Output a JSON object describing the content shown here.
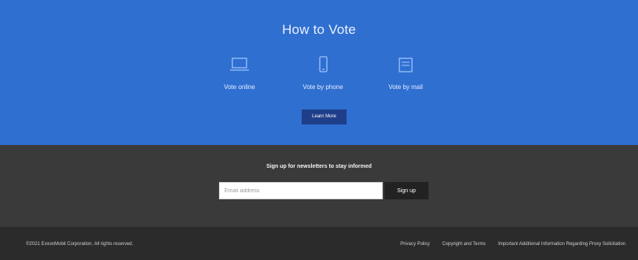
{
  "vote": {
    "title": "How to Vote",
    "options": [
      {
        "label": "Vote online",
        "icon": "laptop-icon"
      },
      {
        "label": "Vote by phone",
        "icon": "phone-icon"
      },
      {
        "label": "Vote by mail",
        "icon": "ballot-mail-icon"
      }
    ],
    "learn_more_label": "Learn More"
  },
  "signup": {
    "heading": "Sign up for newsletters to stay informed",
    "email_placeholder": "Email address",
    "button_label": "Sign up"
  },
  "footer": {
    "copyright": "©2021 ExxonMobil Corporation. All rights reserved.",
    "links": [
      "Privacy Policy",
      "Copyright and Terms",
      "Important Additional Information Regarding Proxy Solicitation"
    ]
  },
  "colors": {
    "vote_bg": "#2f6fd0",
    "signup_bg": "#3a3a3a",
    "footer_bg": "#2b2b2b",
    "learn_button": "#1f3e8a"
  }
}
